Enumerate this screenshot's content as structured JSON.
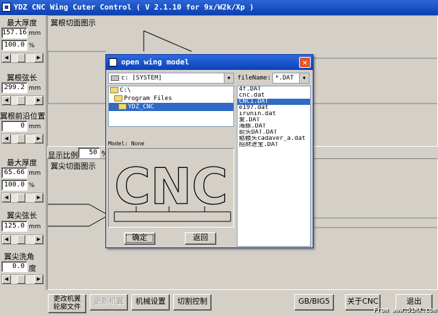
{
  "window": {
    "title": "YDZ CNC Wing Cuter Control ( V 2.1.10 for 9x/W2k/Xp )"
  },
  "root": {
    "max_thickness_label": "最大厚度",
    "max_thickness_value": "157.16",
    "max_thickness_unit": "mm",
    "max_thickness_pct": "100.0",
    "pct_unit": "%",
    "chord_label": "翼根弦长",
    "chord_value": "299.2",
    "chord_unit": "mm",
    "le_label": "翼根前沿位置",
    "le_value": "0",
    "le_unit": "mm",
    "section_title": "翼根切面图示"
  },
  "scale": {
    "label": "显示比例",
    "value": "50",
    "unit": "%"
  },
  "tip": {
    "max_thickness_label": "最大厚度",
    "max_thickness_value": "65.66",
    "max_thickness_unit": "mm",
    "max_thickness_pct": "100.0",
    "pct_unit": "%",
    "chord_label": "翼尖弦长",
    "chord_value": "125.0",
    "chord_unit": "mm",
    "washout_label": "翼尖洗角",
    "washout_value": "0.0",
    "washout_unit": "度",
    "section_title": "翼尖切面图示"
  },
  "toolbar": {
    "change_profile": "更改机翼\n轮廓文件",
    "update_wing": "更新机翼",
    "machine_settings": "机械设置",
    "cut_control": "切割控制",
    "gb_big5": "GB/BIG5",
    "about": "关于CNC",
    "exit": "退出"
  },
  "watermark": "From www.51MX.com",
  "dialog": {
    "title": "open wing model",
    "drive": "c: [SYSTEM]",
    "filename_label": "fileName:",
    "filename_filter": "*.DAT",
    "folders": [
      "C:\\",
      "Program Files",
      "YDZ_CNC"
    ],
    "files": [
      "4f.DAT",
      "cnc.dat",
      "CNC1.DAT",
      "e197.dat",
      "irunin.dat",
      "爱.DAT",
      "海豚.DAT",
      "箭头DAT.DAT",
      "骷髅头cadaver_a.dat",
      "招财进宝.DAT"
    ],
    "selected_file_index": 2,
    "model_label": "Model: None",
    "preview_text": "CNC",
    "ok": "确定",
    "back": "返回"
  }
}
